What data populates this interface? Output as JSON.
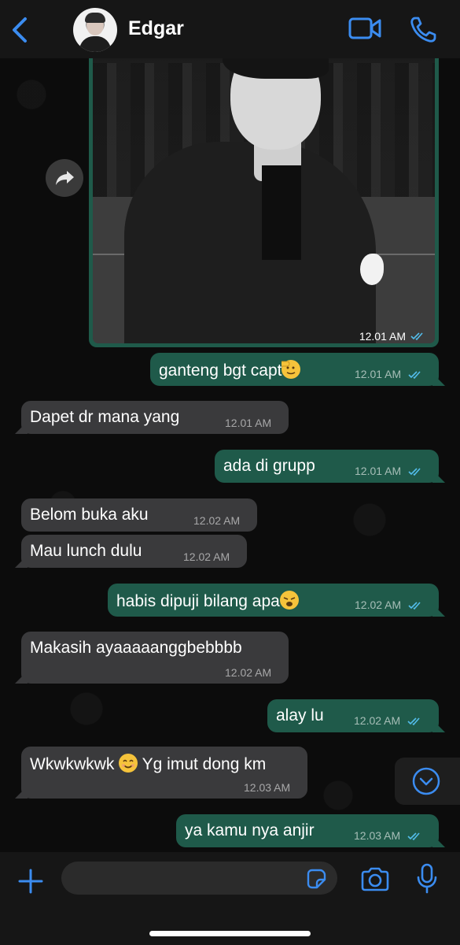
{
  "header": {
    "contact_name": "Edgar"
  },
  "messages": [
    {
      "type": "photo",
      "direction": "out",
      "time": "12.01 AM",
      "status": "read"
    },
    {
      "direction": "out",
      "text": "ganteng bgt capt",
      "emoji": "saluting-face",
      "time": "12.01 AM",
      "status": "read"
    },
    {
      "direction": "in",
      "text": "Dapet dr mana yang",
      "time": "12.01 AM"
    },
    {
      "direction": "out",
      "text": "ada di grupp",
      "time": "12.01 AM",
      "status": "read"
    },
    {
      "direction": "in",
      "text": "Belom buka aku",
      "time": "12.02 AM"
    },
    {
      "direction": "in",
      "text": "Mau lunch dulu",
      "time": "12.02 AM"
    },
    {
      "direction": "out",
      "text": "habis dipuji bilang apa",
      "emoji": "weary-face",
      "time": "12.02 AM",
      "status": "read"
    },
    {
      "direction": "in",
      "text": "Makasih ayaaaaanggbebbbb",
      "time": "12.02 AM"
    },
    {
      "direction": "out",
      "text": "alay lu",
      "time": "12.02 AM",
      "status": "read"
    },
    {
      "direction": "in",
      "text": "Wkwkwkwk",
      "emoji": "smiling-face",
      "text_after": "Yg imut dong km",
      "time": "12.03 AM"
    },
    {
      "direction": "out",
      "text": "ya kamu nya anjir",
      "time": "12.03 AM",
      "status": "read"
    }
  ],
  "colors": {
    "accent": "#3b8cf0",
    "outgoing_bubble": "#1f5a4a",
    "incoming_bubble": "#3a3a3c",
    "read_ticks": "#53bdeb"
  },
  "icons": [
    "chevron-left-icon",
    "video-call-icon",
    "phone-icon",
    "forward-icon",
    "chevron-down-icon",
    "plus-icon",
    "sticker-icon",
    "camera-icon",
    "microphone-icon"
  ]
}
